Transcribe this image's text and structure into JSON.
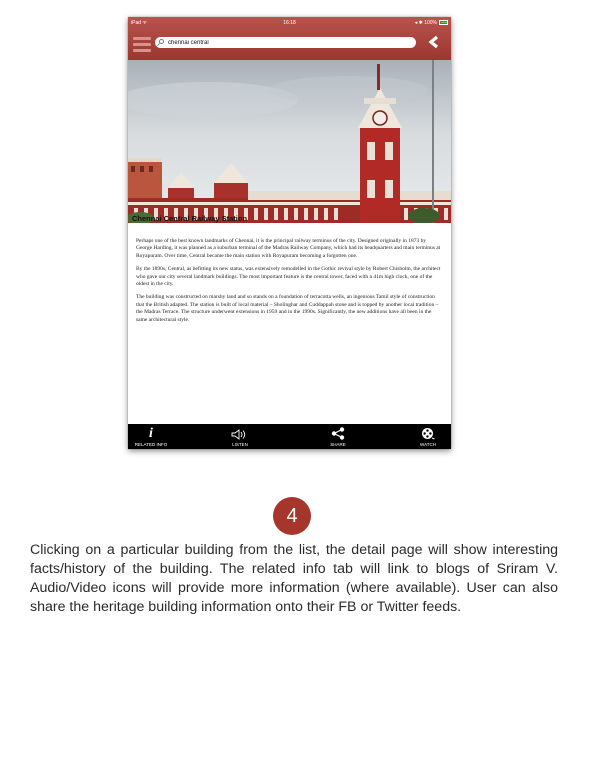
{
  "status_bar": {
    "carrier": "iPad ᯤ",
    "time": "16:18",
    "right_indicators": "◂ ✱ 100%"
  },
  "search": {
    "value": "chennai central",
    "placeholder": ""
  },
  "detail": {
    "title": "Chennai Central Railway Station",
    "paragraphs": [
      "Perhaps one of the best known landmarks of Chennai, it is the principal railway terminus of the city. Designed originally in 1873 by George Harding, it was planned as a suburban terminal of the Madras Railway Company, which had its headquarters and main terminus at Royapuram. Over time, Central became the main station with Royapuram becoming a forgotten one.",
      "By the 1890s, Central, as befitting its new status, was extensively remodelled in the Gothic revival style by Robert Chisholm, the architect who gave our city several landmark buildings. The most important feature is the central tower, faced with a 41m high clock, one of the oldest in the city.",
      "The building was constructed on marshy land and so stands on a foundation of terracotta wells, an ingenious Tamil style of construction that the British adapted. The station is built of local material – Sholinghar and Cuddappah stone and is topped by another local tradition – the Madras Terrace. The structure underwent extensions in 1959 and in the 1990s. Significantly, the new additions have all been in the same architectural style."
    ]
  },
  "tabs": [
    {
      "label": "RELATED INFO",
      "icon": "info-icon"
    },
    {
      "label": "LISTEN",
      "icon": "speaker-icon"
    },
    {
      "label": "SHARE",
      "icon": "share-icon"
    },
    {
      "label": "WATCH",
      "icon": "film-reel-icon"
    }
  ],
  "step_number": "4",
  "caption": "Clicking on a particular building from the list, the detail page will show interesting facts/history of the building. The related info tab will link to blogs of Sriram V. Audio/Video icons will provide more information (where available). User can also share the heritage building information onto their FB or Twitter feeds.",
  "colors": {
    "header_red": "#a8413b",
    "badge_red": "#a6352b",
    "tabbar": "#000000"
  }
}
